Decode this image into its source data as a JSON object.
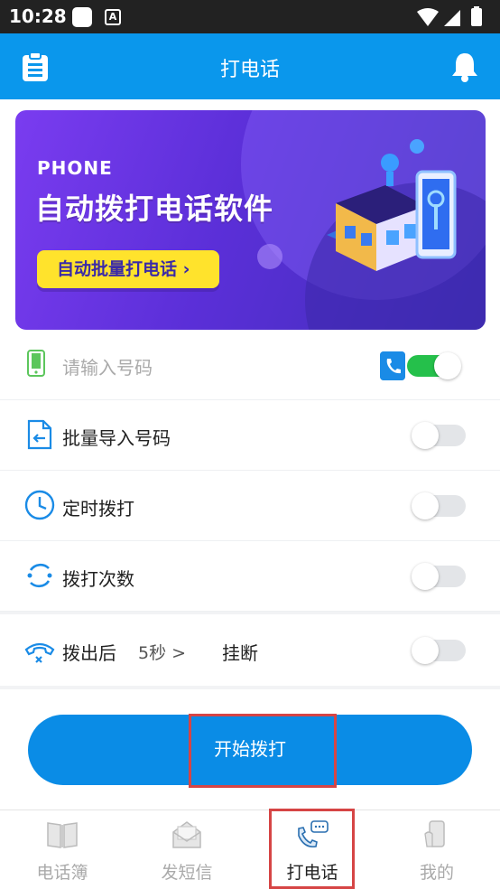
{
  "status_bar": {
    "time": "10:28",
    "notif_icon_a": "A"
  },
  "app_bar": {
    "title": "打电话",
    "left_icon": "clipboard-icon",
    "right_icon": "bell-icon"
  },
  "banner": {
    "eyebrow": "PHONE",
    "headline": "自动拨打电话软件",
    "cta": "自动批量打电话 ›"
  },
  "phone_input": {
    "placeholder": "请输入号码",
    "toggle_on": true
  },
  "options": [
    {
      "label": "批量导入号码",
      "icon": "import-file-icon",
      "enabled": false
    },
    {
      "label": "定时拨打",
      "icon": "clock-icon",
      "enabled": false
    },
    {
      "label": "拨打次数",
      "icon": "refresh-icon",
      "enabled": false
    }
  ],
  "after_call": {
    "label": "拨出后",
    "delay": "5秒 >",
    "action": "挂断",
    "enabled": false
  },
  "start_button": {
    "label": "开始拨打"
  },
  "tabs": [
    {
      "label": "电话簿",
      "icon": "book-icon",
      "active": false
    },
    {
      "label": "发短信",
      "icon": "envelope-icon",
      "active": false
    },
    {
      "label": "打电话",
      "icon": "phone-chat-icon",
      "active": true
    },
    {
      "label": "我的",
      "icon": "mobile-user-icon",
      "active": false
    }
  ],
  "colors": {
    "primary": "#0a97ec",
    "toggle_on": "#25c04b",
    "highlight": "#d64545"
  }
}
